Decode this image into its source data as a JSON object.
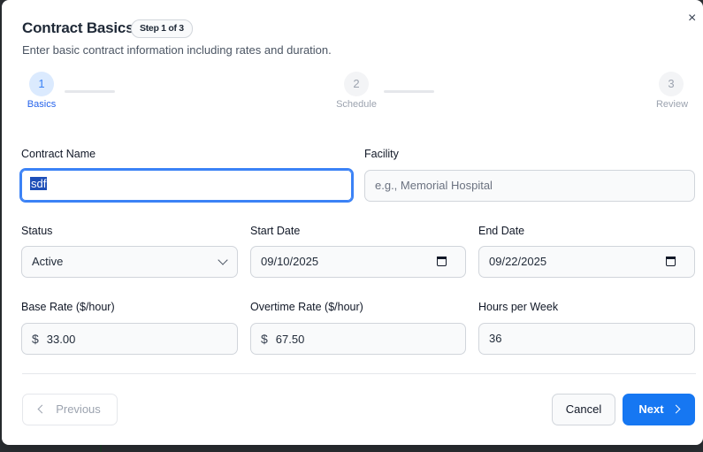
{
  "modal": {
    "title": "Contract Basics",
    "step_badge": "Step 1 of 3",
    "subtitle": "Enter basic contract information including rates and duration.",
    "close_glyph": "×"
  },
  "steps": [
    {
      "number": "1",
      "label": "Basics",
      "state": "active"
    },
    {
      "number": "2",
      "label": "Schedule",
      "state": "inactive"
    },
    {
      "number": "3",
      "label": "Review",
      "state": "inactive"
    }
  ],
  "form": {
    "contract_name": {
      "label": "Contract Name",
      "value": "sdf"
    },
    "facility": {
      "label": "Facility",
      "value": "",
      "placeholder": "e.g., Memorial Hospital"
    },
    "status": {
      "label": "Status",
      "value": "Active"
    },
    "start_date": {
      "label": "Start Date",
      "value": "09/10/2025"
    },
    "end_date": {
      "label": "End Date",
      "value": "09/22/2025"
    },
    "base_rate": {
      "label": "Base Rate ($/hour)",
      "prefix": "$",
      "value": "33.00"
    },
    "overtime_rate": {
      "label": "Overtime Rate ($/hour)",
      "prefix": "$",
      "value": "67.50"
    },
    "hours_per_week": {
      "label": "Hours per Week",
      "value": "36"
    }
  },
  "footer": {
    "previous_label": "Previous",
    "cancel_label": "Cancel",
    "next_label": "Next"
  },
  "colors": {
    "accent": "#1677f2",
    "step_active_bg": "#dbeafe",
    "step_active_text": "#2563eb"
  }
}
